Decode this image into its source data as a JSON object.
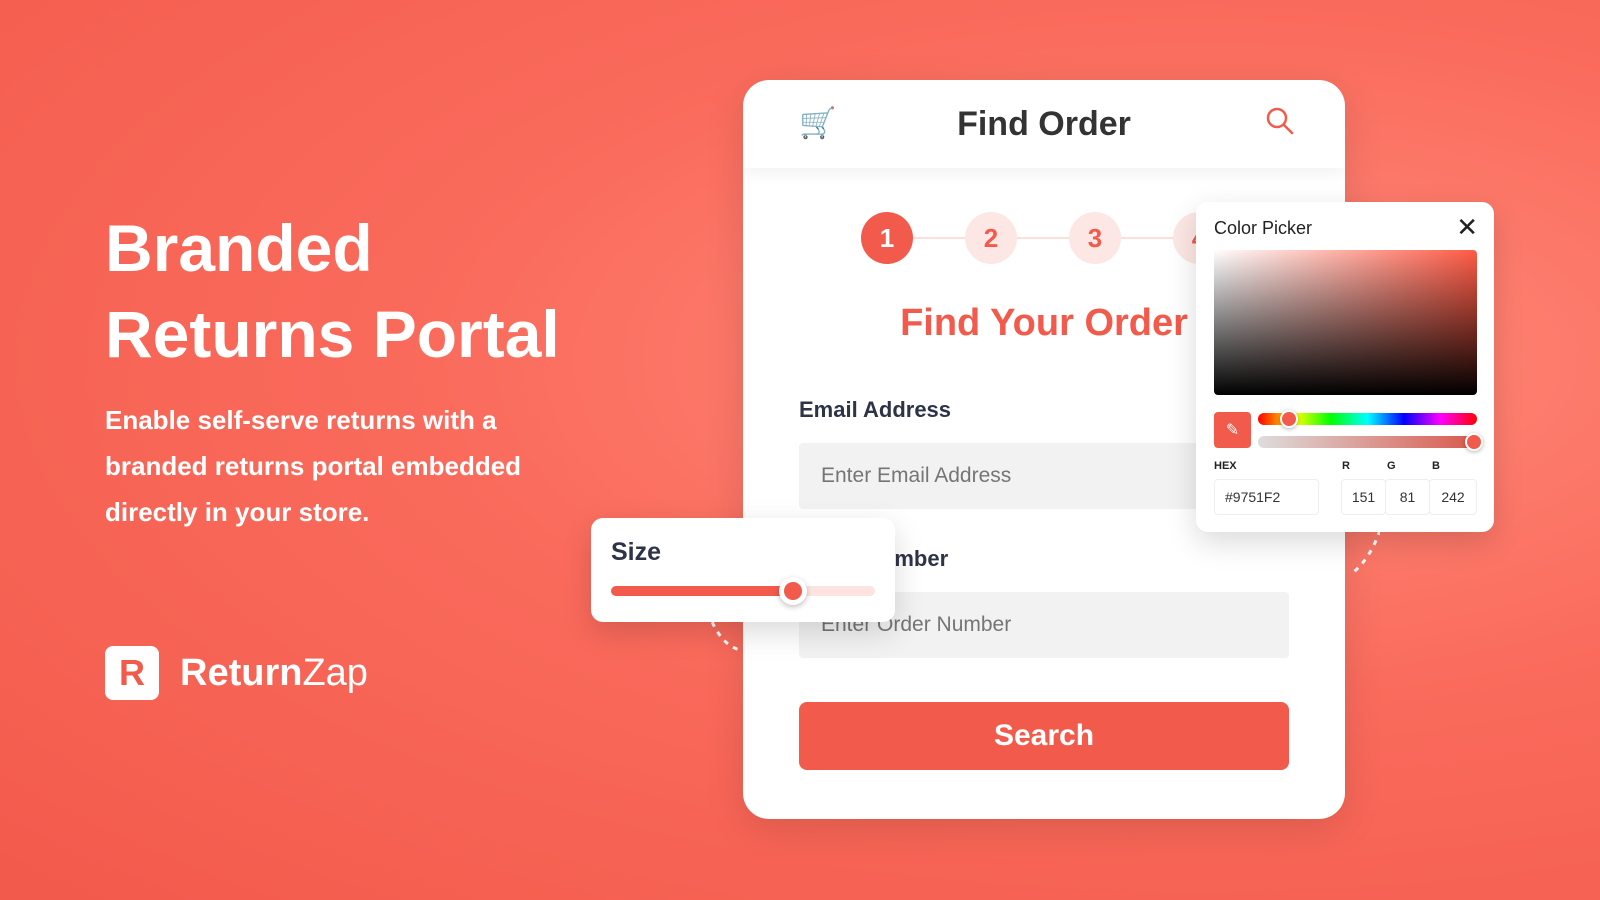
{
  "hero": {
    "title_line1": "Branded",
    "title_line2": "Returns Portal",
    "subtitle": "Enable self-serve returns with a branded returns portal embedded directly in your store."
  },
  "brand": {
    "logo_letter": "R",
    "name_bold": "Return",
    "name_light": "Zap"
  },
  "card": {
    "title": "Find Order",
    "icons": [
      "cart-icon",
      "search-icon"
    ],
    "steps": [
      "1",
      "2",
      "3",
      "4"
    ],
    "active_step": 1,
    "heading": "Find Your Order",
    "email_label": "Email Address",
    "email_placeholder": "Enter Email Address",
    "order_label": "Order Number",
    "order_placeholder": "Enter Order Number",
    "search_label": "Search"
  },
  "size_widget": {
    "label": "Size",
    "value_percent": 69
  },
  "color_picker": {
    "title": "Color Picker",
    "hex_label": "HEX",
    "hex": "#9751F2",
    "r_label": "R",
    "g_label": "G",
    "b_label": "B",
    "r": "151",
    "g": "81",
    "b": "242",
    "hue_percent": 14,
    "alpha_percent": 100
  },
  "colors": {
    "accent": "#f25a4b",
    "background": "#fa6b5c"
  }
}
